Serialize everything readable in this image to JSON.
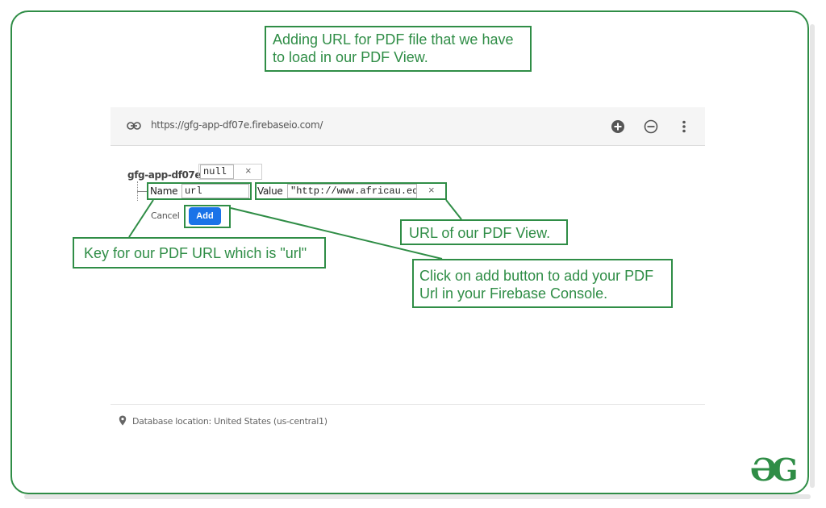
{
  "callouts": {
    "top": [
      "Adding URL for PDF file that we have",
      "to load in our PDF View."
    ],
    "key": "Key for our PDF URL which is \"url\"",
    "url": "URL of our PDF View.",
    "add": [
      "Click on add button to add your PDF",
      "Url in your Firebase Console."
    ]
  },
  "urlbar": {
    "url": "https://gfg-app-df07e.firebaseio.com/",
    "icons": [
      "link-icon",
      "add-circle-icon",
      "remove-circle-icon",
      "more-vert-icon"
    ]
  },
  "node": {
    "key": "gfg-app-df07e:",
    "value": "null"
  },
  "child": {
    "name_label": "Name",
    "name_value": "url",
    "value_label": "Value",
    "value_value": "\"http://www.africau.edu/"
  },
  "buttons": {
    "cancel": "Cancel",
    "add": "Add",
    "close": "×"
  },
  "footer": {
    "location": "Database location: United States (us-central1)"
  },
  "logo": "ƏG",
  "colors": {
    "accent_green": "#2f8d46",
    "add_button_blue": "#1a73e8"
  }
}
